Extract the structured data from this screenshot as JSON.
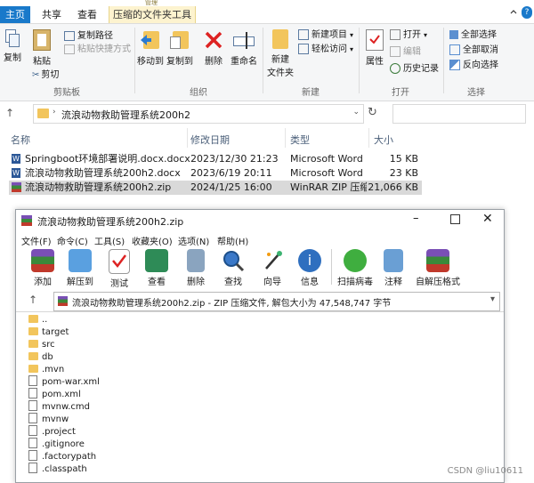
{
  "explorer": {
    "ribbon_tabs": [
      "主页",
      "共享",
      "查看"
    ],
    "context_tab_group": "管理",
    "context_tab": "压缩的文件夹工具",
    "ribbon": {
      "copy": "复制",
      "paste": "粘贴",
      "copy_path": "复制路径",
      "paste_shortcut": "粘贴快捷方式",
      "cut": "剪切",
      "clipboard_group": "剪贴板",
      "move_to": "移动到",
      "copy_to": "复制到",
      "delete": "删除",
      "rename": "重命名",
      "organize_group": "组织",
      "new_folder_line1": "新建",
      "new_folder_line2": "文件夹",
      "new_item": "新建项目",
      "easy_access": "轻松访问",
      "new_group": "新建",
      "properties": "属性",
      "open": "打开",
      "edit": "编辑",
      "history": "历史记录",
      "open_group": "打开",
      "select_all": "全部选择",
      "select_none": "全部取消",
      "invert_selection": "反向选择",
      "select_group": "选择"
    },
    "address": "流浪动物救助管理系统200h2",
    "columns": {
      "name": "名称",
      "modified": "修改日期",
      "type": "类型",
      "size": "大小"
    },
    "files": [
      {
        "name": "Springboot环境部署说明.docx.docx",
        "date": "2023/12/30 21:23",
        "type": "Microsoft Word ...",
        "size": "15 KB",
        "icon": "word-doc-icon"
      },
      {
        "name": "流浪动物救助管理系统200h2.docx",
        "date": "2023/6/19 20:11",
        "type": "Microsoft Word ...",
        "size": "23 KB",
        "icon": "word-doc-icon"
      },
      {
        "name": "流浪动物救助管理系统200h2.zip",
        "date": "2024/1/25 16:00",
        "type": "WinRAR ZIP 压缩...",
        "size": "21,066 KB",
        "icon": "winrar-zip-icon"
      }
    ]
  },
  "winrar": {
    "title": "流浪动物救助管理系统200h2.zip",
    "menu": [
      "文件(F)",
      "命令(C)",
      "工具(S)",
      "收藏夹(O)",
      "选项(N)",
      "帮助(H)"
    ],
    "toolbar": [
      "添加",
      "解压到",
      "测试",
      "查看",
      "删除",
      "查找",
      "向导",
      "信息",
      "扫描病毒",
      "注释",
      "自解压格式"
    ],
    "path_bar": "流浪动物救助管理系统200h2.zip - ZIP 压缩文件, 解包大小为 47,548,747 字节",
    "entries": [
      {
        "name": "..",
        "kind": "folder"
      },
      {
        "name": "target",
        "kind": "folder"
      },
      {
        "name": "src",
        "kind": "folder"
      },
      {
        "name": "db",
        "kind": "folder"
      },
      {
        "name": ".mvn",
        "kind": "folder"
      },
      {
        "name": "pom-war.xml",
        "kind": "file"
      },
      {
        "name": "pom.xml",
        "kind": "file"
      },
      {
        "name": "mvnw.cmd",
        "kind": "file"
      },
      {
        "name": "mvnw",
        "kind": "file"
      },
      {
        "name": ".project",
        "kind": "file"
      },
      {
        "name": ".gitignore",
        "kind": "file"
      },
      {
        "name": ".factorypath",
        "kind": "file"
      },
      {
        "name": ".classpath",
        "kind": "file"
      }
    ]
  },
  "watermark": "CSDN @liu10611",
  "colors": {
    "accent": "#1979ca",
    "selection": "#d9d9d9",
    "context_tab": "#fdf3cf",
    "folder": "#f2c55c"
  }
}
